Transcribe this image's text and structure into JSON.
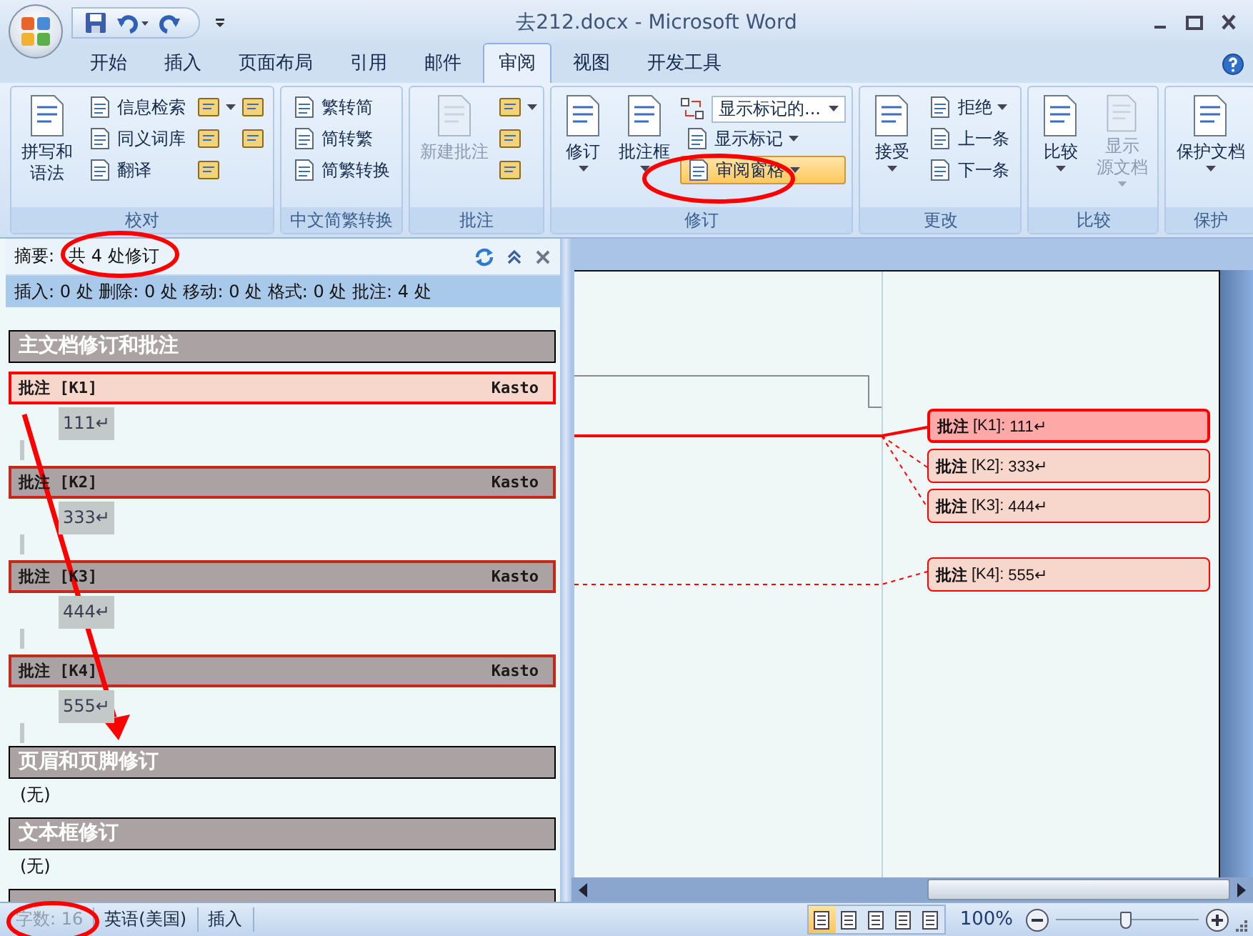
{
  "window": {
    "title": "去212.docx - Microsoft Word"
  },
  "tabs": [
    {
      "label": "开始",
      "selected": false
    },
    {
      "label": "插入",
      "selected": false
    },
    {
      "label": "页面布局",
      "selected": false
    },
    {
      "label": "引用",
      "selected": false
    },
    {
      "label": "邮件",
      "selected": false
    },
    {
      "label": "审阅",
      "selected": true
    },
    {
      "label": "视图",
      "selected": false
    },
    {
      "label": "开发工具",
      "selected": false
    }
  ],
  "ribbon_groups": [
    {
      "title": "校对",
      "items": [
        {
          "kind": "large",
          "lines": [
            "拼写和",
            "语法"
          ],
          "menu": false,
          "disabled": false
        },
        {
          "kind": "small",
          "label": "信息检索",
          "menu": false,
          "selected": false
        },
        {
          "kind": "small",
          "label": "同义词库",
          "menu": false,
          "selected": false
        },
        {
          "kind": "small",
          "label": "翻译",
          "menu": false,
          "selected": false
        },
        {
          "kind": "icon",
          "menu": true
        },
        {
          "kind": "icon",
          "menu": false
        },
        {
          "kind": "icon",
          "menu": false
        },
        {
          "kind": "icon",
          "menu": false
        },
        {
          "kind": "icon",
          "menu": false
        }
      ]
    },
    {
      "title": "中文简繁转换",
      "items": [
        {
          "kind": "small",
          "label": "繁转简",
          "menu": false,
          "selected": false
        },
        {
          "kind": "small",
          "label": "简转繁",
          "menu": false,
          "selected": false
        },
        {
          "kind": "small",
          "label": "简繁转换",
          "menu": false,
          "selected": false
        }
      ]
    },
    {
      "title": "批注",
      "items": [
        {
          "kind": "large",
          "lines": [
            "新建批注"
          ],
          "menu": false,
          "disabled": true
        },
        {
          "kind": "icon",
          "menu": true
        },
        {
          "kind": "icon",
          "menu": false
        },
        {
          "kind": "icon",
          "menu": false
        }
      ]
    },
    {
      "title": "修订",
      "items": [
        {
          "kind": "large",
          "lines": [
            "修订"
          ],
          "menu": true,
          "disabled": false
        },
        {
          "kind": "large",
          "lines": [
            "批注框"
          ],
          "menu": true,
          "disabled": false
        },
        {
          "kind": "combo",
          "label": "显示标记的..."
        },
        {
          "kind": "small",
          "label": "显示标记",
          "menu": true,
          "selected": false
        },
        {
          "kind": "small",
          "label": "审阅窗格",
          "menu": true,
          "selected": true
        }
      ]
    },
    {
      "title": "更改",
      "items": [
        {
          "kind": "large",
          "lines": [
            "接受"
          ],
          "menu": true,
          "disabled": false
        },
        {
          "kind": "small",
          "label": "拒绝",
          "menu": true,
          "selected": false
        },
        {
          "kind": "small",
          "label": "上一条",
          "menu": false,
          "selected": false
        },
        {
          "kind": "small",
          "label": "下一条",
          "menu": false,
          "selected": false
        }
      ]
    },
    {
      "title": "比较",
      "items": [
        {
          "kind": "large",
          "lines": [
            "比较"
          ],
          "menu": true,
          "disabled": false
        },
        {
          "kind": "large",
          "lines": [
            "显示",
            "源文档"
          ],
          "menu": true,
          "disabled": true
        }
      ]
    },
    {
      "title": "保护",
      "items": [
        {
          "kind": "large",
          "lines": [
            "保护文档"
          ],
          "menu": true,
          "disabled": false
        }
      ]
    }
  ],
  "review_pane": {
    "summary_label": "摘要:",
    "summary": "共 4 处修订",
    "counts": "插入: 0 处 删除: 0 处 移动: 0 处 格式: 0 处 批注: 4 处",
    "sections": [
      {
        "heading": "主文档修订和批注",
        "comments": [
          {
            "label": "批注 [K1]",
            "author": "Kasto",
            "text": "111↵",
            "selected": true
          },
          {
            "label": "批注 [K2]",
            "author": "Kasto",
            "text": "333↵",
            "selected": false
          },
          {
            "label": "批注 [K3]",
            "author": "Kasto",
            "text": "444↵",
            "selected": false
          },
          {
            "label": "批注 [K4]",
            "author": "Kasto",
            "text": "555↵",
            "selected": false
          }
        ]
      },
      {
        "heading": "页眉和页脚修订",
        "empty_text": "(无)"
      },
      {
        "heading": "文本框修订",
        "empty_text": "(无)"
      }
    ],
    "more_below": true
  },
  "document": {
    "balloons": [
      {
        "label": "批注",
        "ref": "[K1]:",
        "text": "111↵",
        "selected": true
      },
      {
        "label": "批注",
        "ref": "[K2]:",
        "text": "333↵",
        "selected": false
      },
      {
        "label": "批注",
        "ref": "[K3]:",
        "text": "444↵",
        "selected": false
      },
      {
        "label": "批注",
        "ref": "[K4]:",
        "text": "555↵",
        "selected": false
      }
    ]
  },
  "status_bar": {
    "items": [
      {
        "label": "字数: 16",
        "disabled": true
      },
      {
        "label": "英语(美国)",
        "disabled": false
      },
      {
        "label": "插入",
        "disabled": false
      }
    ],
    "views": [
      {
        "selected": true
      },
      {
        "selected": false
      },
      {
        "selected": false
      },
      {
        "selected": false
      },
      {
        "selected": false
      }
    ],
    "zoom": {
      "label": "100%",
      "level": 0.49
    }
  }
}
